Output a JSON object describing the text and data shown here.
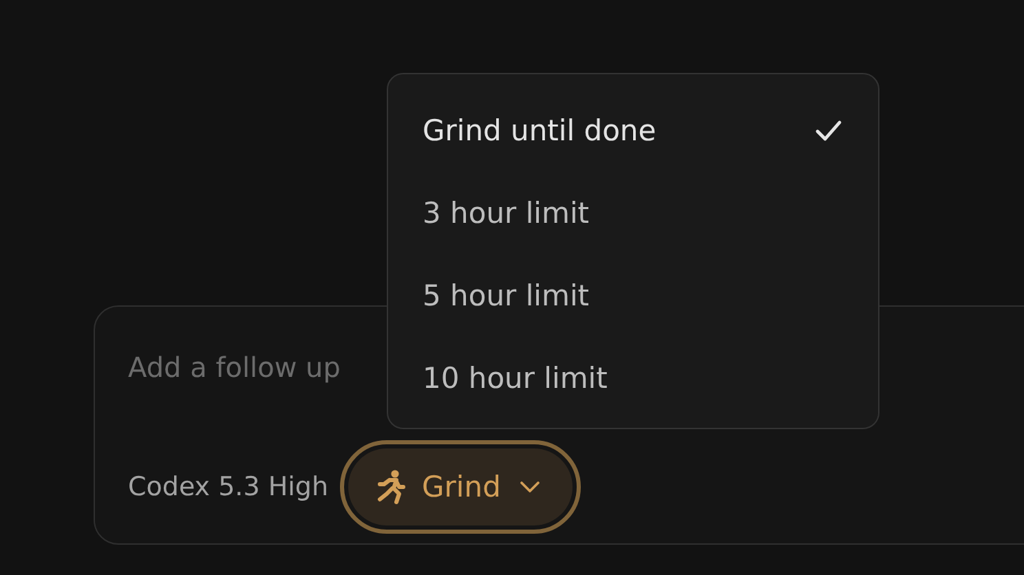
{
  "composer": {
    "placeholder": "Add a follow up",
    "model": "Codex 5.3 High",
    "mode_button": {
      "label": "Grind",
      "expanded": true
    }
  },
  "mode_menu": {
    "items": [
      {
        "label": "Grind until done",
        "selected": true
      },
      {
        "label": "3 hour limit",
        "selected": false
      },
      {
        "label": "5 hour limit",
        "selected": false
      },
      {
        "label": "10 hour limit",
        "selected": false
      }
    ]
  }
}
